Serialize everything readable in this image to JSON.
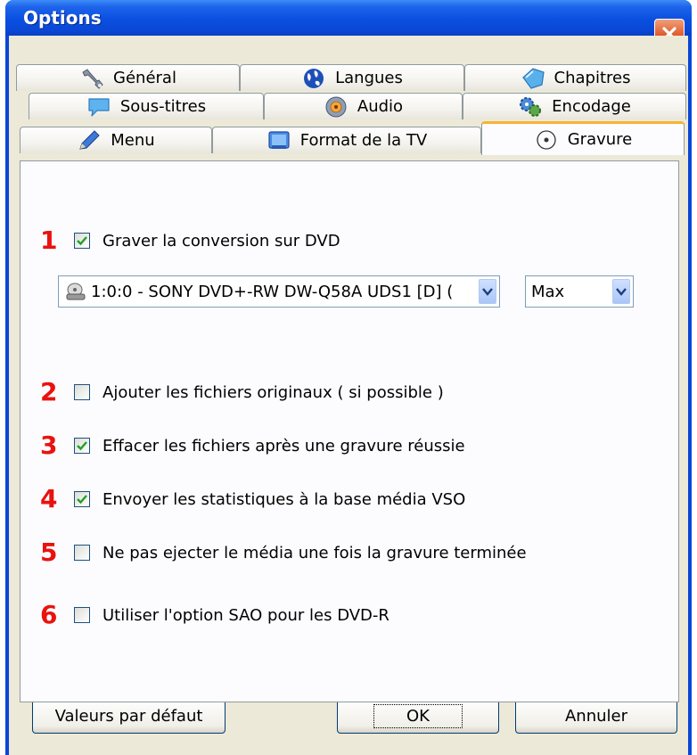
{
  "window": {
    "title": "Options",
    "close_icon": "close-icon",
    "close_color": "#df5a2a",
    "titlebar_color": "#0a4fe0"
  },
  "tabs": {
    "row1": [
      {
        "label": "Général",
        "icon": "tools-icon"
      },
      {
        "label": "Langues",
        "icon": "globe-icon"
      },
      {
        "label": "Chapitres",
        "icon": "tag-icon"
      }
    ],
    "row2": [
      {
        "label": "Sous-titres",
        "icon": "speech-bubble-icon"
      },
      {
        "label": "Audio",
        "icon": "speaker-icon"
      },
      {
        "label": "Encodage",
        "icon": "gears-icon"
      }
    ],
    "row3": [
      {
        "label": "Menu",
        "icon": "pencil-icon"
      },
      {
        "label": "Format de la TV",
        "icon": "monitor-icon"
      },
      {
        "label": "Gravure",
        "icon": "disc-icon",
        "active": true
      }
    ]
  },
  "gravure": {
    "drive_select": {
      "value": "1:0:0 - SONY DVD+-RW DW-Q58A UDS1 [D] (",
      "icon": "drive-icon"
    },
    "speed_select": {
      "value": "Max"
    },
    "options": [
      {
        "number": "1",
        "label": "Graver la conversion sur DVD",
        "checked": true
      },
      {
        "number": "2",
        "label": "Ajouter les fichiers originaux ( si possible )",
        "checked": false
      },
      {
        "number": "3",
        "label": "Effacer les fichiers après une gravure réussie",
        "checked": true
      },
      {
        "number": "4",
        "label": "Envoyer les statistiques à la base média VSO",
        "checked": true
      },
      {
        "number": "5",
        "label": "Ne pas ejecter le média une fois la gravure terminée",
        "checked": false
      },
      {
        "number": "6",
        "label": "Utiliser l'option SAO pour les DVD-R",
        "checked": false
      }
    ],
    "number_color": "#e8130f",
    "check_color": "#21a121"
  },
  "buttons": {
    "defaults": "Valeurs par défaut",
    "ok": "OK",
    "cancel": "Annuler"
  }
}
